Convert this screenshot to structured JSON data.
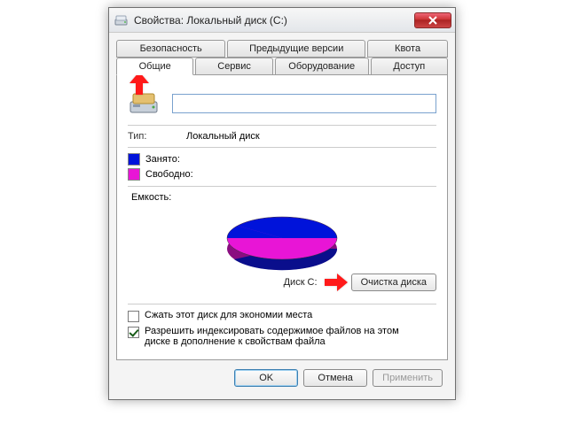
{
  "window": {
    "title": "Свойства: Локальный диск (C:)"
  },
  "tabs_top": {
    "security": "Безопасность",
    "previous": "Предыдущие версии",
    "quota": "Квота"
  },
  "tabs_bottom": {
    "general": "Общие",
    "tools": "Сервис",
    "hardware": "Оборудование",
    "sharing": "Доступ"
  },
  "general": {
    "name_value": "",
    "type_label": "Тип:",
    "type_value": "Локальный диск",
    "used_label": "Занято:",
    "free_label": "Свободно:",
    "capacity_label": "Емкость:",
    "disk_label": "Диск C:",
    "cleanup_button": "Очистка диска",
    "compress_checkbox": "Сжать этот диск для экономии места",
    "index_checkbox": "Разрешить индексировать содержимое файлов на этом диске в дополнение к свойствам файла"
  },
  "buttons": {
    "ok": "OK",
    "cancel": "Отмена",
    "apply": "Применить"
  },
  "chart_data": {
    "type": "pie",
    "title": "",
    "series": [
      {
        "name": "Занято",
        "value": 55,
        "color": "#0013da"
      },
      {
        "name": "Свободно",
        "value": 45,
        "color": "#e815d6"
      }
    ]
  }
}
